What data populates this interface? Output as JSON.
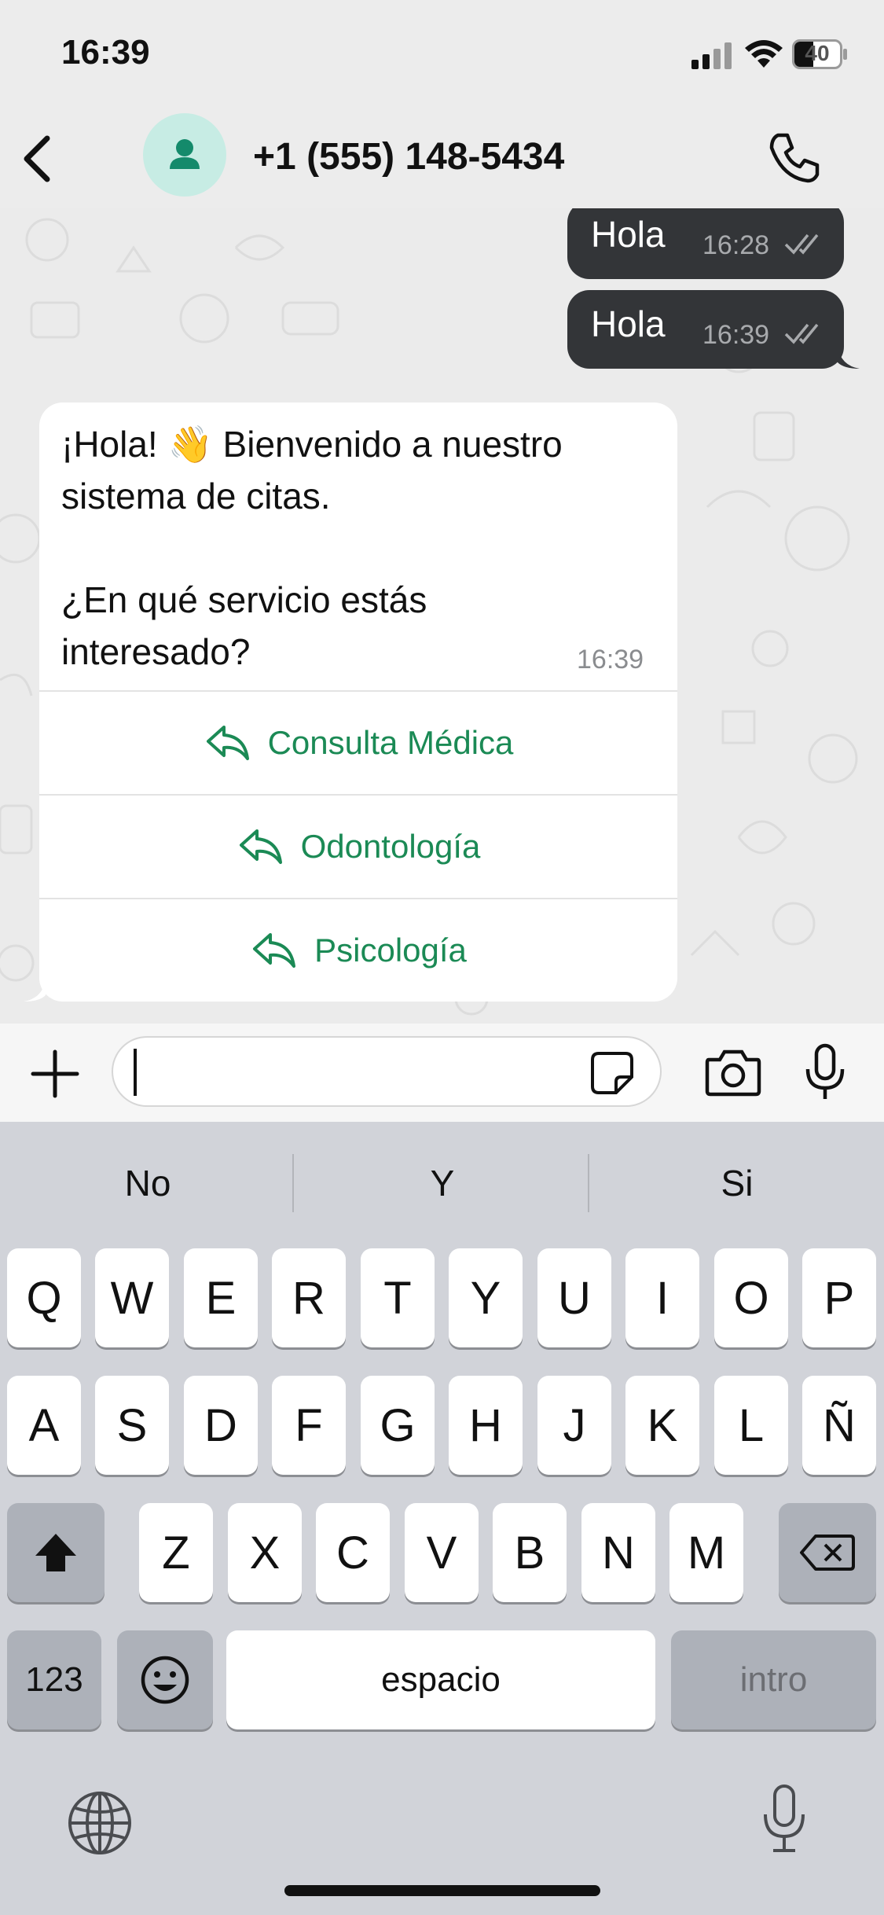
{
  "status_bar": {
    "time": "16:39",
    "battery": "40"
  },
  "header": {
    "contact": "+1 (555) 148-5434"
  },
  "messages": [
    {
      "text": "Hola",
      "time": "16:28"
    },
    {
      "text": "Hola",
      "time": "16:39"
    }
  ],
  "bot_message": {
    "line1": "¡Hola! 👋 Bienvenido a nuestro",
    "line2": "sistema de citas.",
    "line3": "¿En qué servicio estás",
    "line4": "interesado?",
    "time": "16:39",
    "options": [
      "Consulta Médica",
      "Odontología",
      "Psicología"
    ]
  },
  "keyboard": {
    "suggestions": [
      "No",
      "Y",
      "Si"
    ],
    "row1": [
      "Q",
      "W",
      "E",
      "R",
      "T",
      "Y",
      "U",
      "I",
      "O",
      "P"
    ],
    "row2": [
      "A",
      "S",
      "D",
      "F",
      "G",
      "H",
      "J",
      "K",
      "L",
      "Ñ"
    ],
    "row3": [
      "Z",
      "X",
      "C",
      "V",
      "B",
      "N",
      "M"
    ],
    "num_label": "123",
    "space_label": "espacio",
    "return_label": "intro"
  }
}
